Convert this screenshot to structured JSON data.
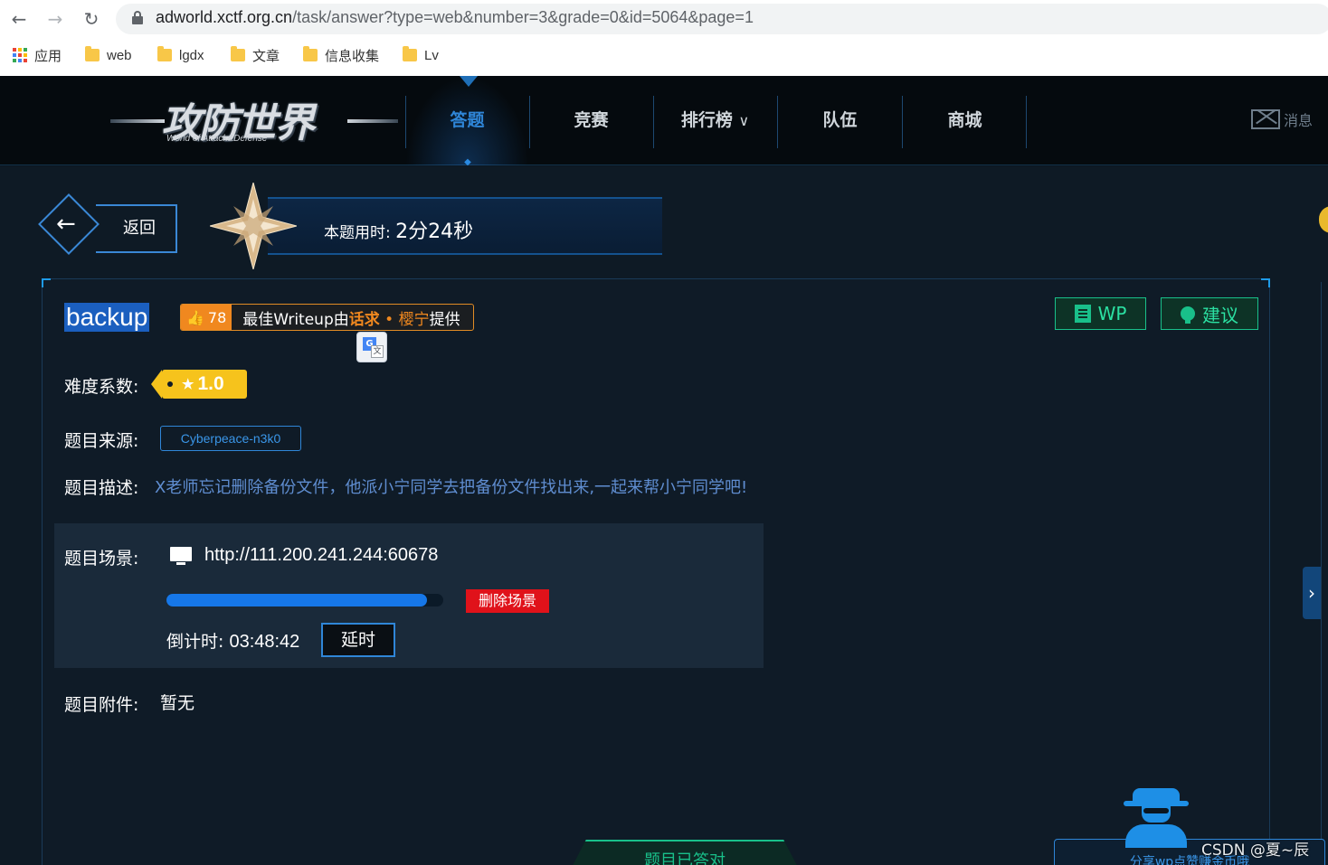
{
  "browser": {
    "url_host": "adworld.xctf.org.cn",
    "url_rest": "/task/answer?type=web&number=3&grade=0&id=5064&page=1",
    "bookmarks": [
      {
        "label": "应用",
        "icon": "apps-grid-icon"
      },
      {
        "label": "web",
        "icon": "folder-icon"
      },
      {
        "label": "lgdx",
        "icon": "folder-icon"
      },
      {
        "label": "文章",
        "icon": "folder-icon"
      },
      {
        "label": "信息收集",
        "icon": "folder-icon"
      },
      {
        "label": "Lv",
        "icon": "folder-icon"
      }
    ]
  },
  "site": {
    "logo_text": "攻防世界",
    "logo_sub": "World of Attack&Defense",
    "nav": [
      {
        "label": "答题",
        "active": true
      },
      {
        "label": "竞赛",
        "active": false
      },
      {
        "label": "排行榜",
        "active": false,
        "dropdown": true
      },
      {
        "label": "队伍",
        "active": false
      },
      {
        "label": "商城",
        "active": false
      }
    ],
    "messages_label": "消息",
    "accent_color": "#2f86d8"
  },
  "task": {
    "back_label": "返回",
    "timer_label": "本题用时:",
    "timer_value": "2分24秒",
    "title": "backup",
    "likes": "78",
    "writeup_prefix": "最佳Writeup由",
    "writeup_team": "话求",
    "writeup_dot": " • ",
    "writeup_author": "樱宁",
    "writeup_suffix": "提供",
    "wp_label": "WP",
    "suggest_label": "建议",
    "difficulty_label": "难度系数:",
    "difficulty_value": "1.0",
    "source_label": "题目来源:",
    "source_value": "Cyberpeace-n3k0",
    "desc_label": "题目描述:",
    "desc_value": "X老师忘记删除备份文件，他派小宁同学去把备份文件找出来,一起来帮小宁同学吧!",
    "scene_label": "题目场景:",
    "scene_url": "http://111.200.241.244:60678",
    "scene_progress": 0.94,
    "delete_label": "删除场景",
    "countdown_label": "倒计时:",
    "countdown_value": "03:48:42",
    "extend_label": "延时",
    "attach_label": "题目附件:",
    "attach_value": "暂无",
    "answered_label": "题目已答对",
    "share_label": "分享wp点赞赚金币哦",
    "watermark": "CSDN @夏~辰"
  }
}
